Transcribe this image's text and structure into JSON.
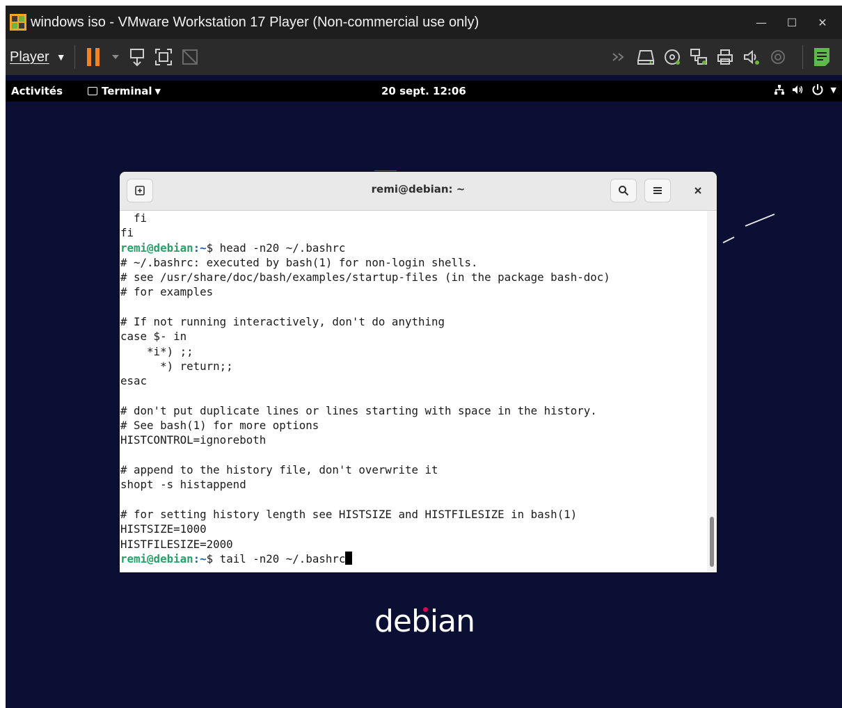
{
  "window": {
    "title": "windows iso - VMware Workstation 17 Player (Non-commercial use only)",
    "controls": {
      "minimize": "—",
      "maximize": "☐",
      "close": "✕"
    }
  },
  "toolbar": {
    "player_menu": "Player",
    "left_icons": [
      "pause-icon",
      "dropdown-arrow-icon",
      "send-ctrl-alt-del-icon",
      "fullscreen-icon",
      "unity-icon"
    ],
    "right_icons": [
      "forward-icon",
      "hard-disk-icon",
      "cd-drive-icon",
      "network-adapter-icon",
      "printer-icon",
      "sound-card-icon",
      "usb-icon",
      "notes-icon"
    ],
    "accent": "#f5821f"
  },
  "gnome": {
    "activities": "Activités",
    "app_menu": "Terminal",
    "clock": "20 sept. 12:06"
  },
  "terminal": {
    "title": "remi@debian: ~",
    "lines": [
      {
        "text": "  fi"
      },
      {
        "text": "fi"
      },
      {
        "prompt_user": "remi@debian",
        "prompt_path": ":~",
        "cmd": "$ head -n20 ~/.bashrc"
      },
      {
        "text": "# ~/.bashrc: executed by bash(1) for non-login shells."
      },
      {
        "text": "# see /usr/share/doc/bash/examples/startup-files (in the package bash-doc)"
      },
      {
        "text": "# for examples"
      },
      {
        "text": ""
      },
      {
        "text": "# If not running interactively, don't do anything"
      },
      {
        "text": "case $- in"
      },
      {
        "text": "    *i*) ;;"
      },
      {
        "text": "      *) return;;"
      },
      {
        "text": "esac"
      },
      {
        "text": ""
      },
      {
        "text": "# don't put duplicate lines or lines starting with space in the history."
      },
      {
        "text": "# See bash(1) for more options"
      },
      {
        "text": "HISTCONTROL=ignoreboth"
      },
      {
        "text": ""
      },
      {
        "text": "# append to the history file, don't overwrite it"
      },
      {
        "text": "shopt -s histappend"
      },
      {
        "text": ""
      },
      {
        "text": "# for setting history length see HISTSIZE and HISTFILESIZE in bash(1)"
      },
      {
        "text": "HISTSIZE=1000"
      },
      {
        "text": "HISTFILESIZE=2000"
      },
      {
        "prompt_user": "remi@debian",
        "prompt_path": ":~",
        "cmd": "$ tail -n20 ~/.bashrc",
        "cursor": true
      }
    ]
  },
  "desktop": {
    "logo_text": "debian"
  }
}
